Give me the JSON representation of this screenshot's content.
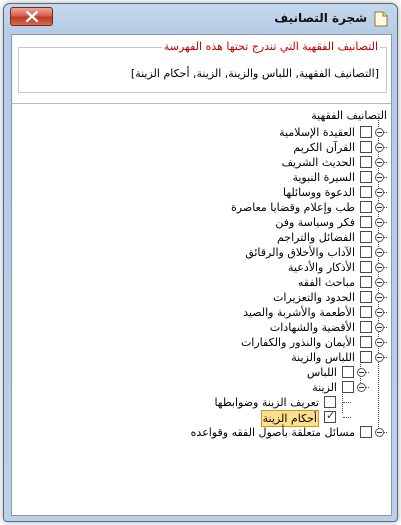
{
  "window": {
    "title": "شجرة التصانيف"
  },
  "group": {
    "label": "التصانيف الفقهية التي تندرج تحتها هذه الفهرسة",
    "value": "[التصانيف الفقهية, اللباس والزينة, الزينة, أحكام الزينة]"
  },
  "tree": {
    "root": "التصانيف الفقهية",
    "items": [
      {
        "label": "العقيدة الإسلامية",
        "checked": false
      },
      {
        "label": "القرآن الكريم",
        "checked": false
      },
      {
        "label": "الحديث الشريف",
        "checked": false
      },
      {
        "label": "السيرة النبوية",
        "checked": false
      },
      {
        "label": "الدعوة ووسائلها",
        "checked": false
      },
      {
        "label": "طب وإعلام وقضايا معاصرة",
        "checked": false
      },
      {
        "label": "فكر وسياسة وفن",
        "checked": false
      },
      {
        "label": "الفضائل والتراجم",
        "checked": false
      },
      {
        "label": "الآداب والأخلاق والرقائق",
        "checked": false
      },
      {
        "label": "الأذكار والأدعية",
        "checked": false
      },
      {
        "label": "مباحث الفقه",
        "checked": false
      },
      {
        "label": "الحدود والتعزيرات",
        "checked": false
      },
      {
        "label": "الأطعمة والأشربة والصيد",
        "checked": false
      },
      {
        "label": "الأقضية والشهادات",
        "checked": false
      },
      {
        "label": "الأيمان والنذور والكفارات",
        "checked": false
      },
      {
        "label": "اللباس والزينة",
        "checked": false
      }
    ],
    "sub_level1": [
      {
        "label": "اللباس",
        "checked": false
      },
      {
        "label": "الزينة",
        "checked": false
      }
    ],
    "sub_level2": [
      {
        "label": "تعريف الزينة وضوابطها",
        "checked": false
      },
      {
        "label": "أحكام الزينة",
        "checked": true
      }
    ],
    "last_item": {
      "label": "مسائل متعلقة بأصول الفقه وقواعده",
      "checked": false
    }
  }
}
